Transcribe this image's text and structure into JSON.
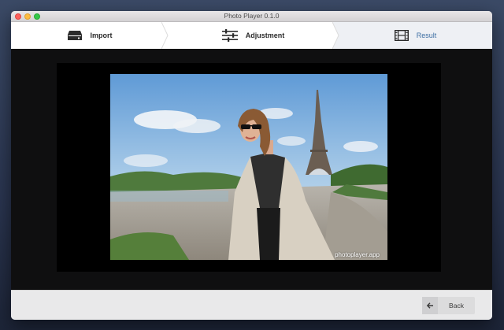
{
  "window": {
    "title": "Photo Player 0.1.0"
  },
  "steps": [
    {
      "label": "Import",
      "icon": "drive-icon"
    },
    {
      "label": "Adjustment",
      "icon": "sliders-icon"
    },
    {
      "label": "Result",
      "icon": "film-icon",
      "active": true
    }
  ],
  "preview": {
    "watermark": "photoplayer.app"
  },
  "footer": {
    "back_label": "Back",
    "back_icon": "arrow-left-icon"
  },
  "colors": {
    "active_step_text": "#3e6fa3",
    "active_step_bg": "#eef0f4"
  }
}
